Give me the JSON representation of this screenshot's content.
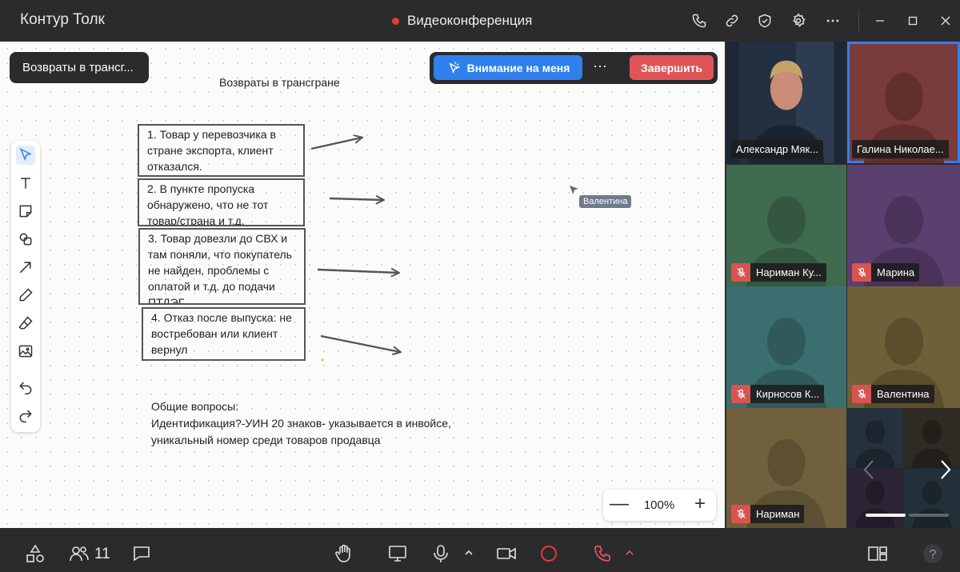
{
  "titlebar": {
    "app_title": "Контур Толк",
    "conference_title": "Видеоконференция",
    "icons": [
      "phone-icon",
      "link-icon",
      "shield-check-icon",
      "gear-icon",
      "more-icon"
    ],
    "window_controls": [
      "minimize-icon",
      "maximize-icon",
      "close-icon"
    ]
  },
  "board": {
    "name": "Возвраты в трансг...",
    "heading": "Возвраты в трансгране",
    "attention_label": "Внимание на меня",
    "more_label": "···",
    "finish_label": "Завершить",
    "notes": [
      "1. Товар у перевозчика в стране экспорта, клиент отказался.",
      "2. В пункте пропуска обнаружено, что не тот товар/страна и т.д.",
      "3. Товар довезли до СВХ и там поняли, что покупатель не найден, проблемы с оплатой и т.д. до подачи ПТДЭГ",
      "4. Отказ  после выпуска: не востребован или клиент вернул"
    ],
    "general_text": "Общие вопросы:\nИдентификация?-УИН 20 знаков- указывается в инвойсе,\nуникальный номер среди товаров продавца",
    "cursor_user": "Валентина",
    "tools": [
      "select-icon",
      "text-icon",
      "sticky-note-icon",
      "shapes-icon",
      "arrow-icon",
      "pen-icon",
      "eraser-icon",
      "image-icon",
      "undo-icon",
      "redo-icon"
    ],
    "zoom": {
      "out_label": "—",
      "value": "100%",
      "in_label": "+"
    }
  },
  "participants": [
    {
      "name": "Александр Мяк...",
      "muted": false,
      "bg": "#1d2836",
      "video": true
    },
    {
      "name": "Галина Николае...",
      "muted": false,
      "bg": "#7a3b3b",
      "video": false
    },
    {
      "name": "Нариман Ку...",
      "muted": true,
      "bg": "#3f6b4f",
      "video": false
    },
    {
      "name": "Марина",
      "muted": true,
      "bg": "#5b3f6e",
      "video": false
    },
    {
      "name": "Кирносов К...",
      "muted": true,
      "bg": "#3b6e6e",
      "video": false
    },
    {
      "name": "Валентина",
      "muted": true,
      "bg": "#6e6038",
      "video": false
    },
    {
      "name": "Нариман",
      "muted": true,
      "bg": "#70603d",
      "video": false
    }
  ],
  "bottombar": {
    "participant_count": "11",
    "icons": [
      "shapes-menu-icon",
      "participants-icon",
      "chat-icon",
      "raise-hand-icon",
      "screen-share-icon",
      "microphone-icon",
      "camera-icon",
      "record-icon",
      "hang-up-icon",
      "layout-icon",
      "help-icon"
    ]
  },
  "colors": {
    "accent": "#2f80ed",
    "danger": "#e05457",
    "background": "#2b2b2e"
  }
}
